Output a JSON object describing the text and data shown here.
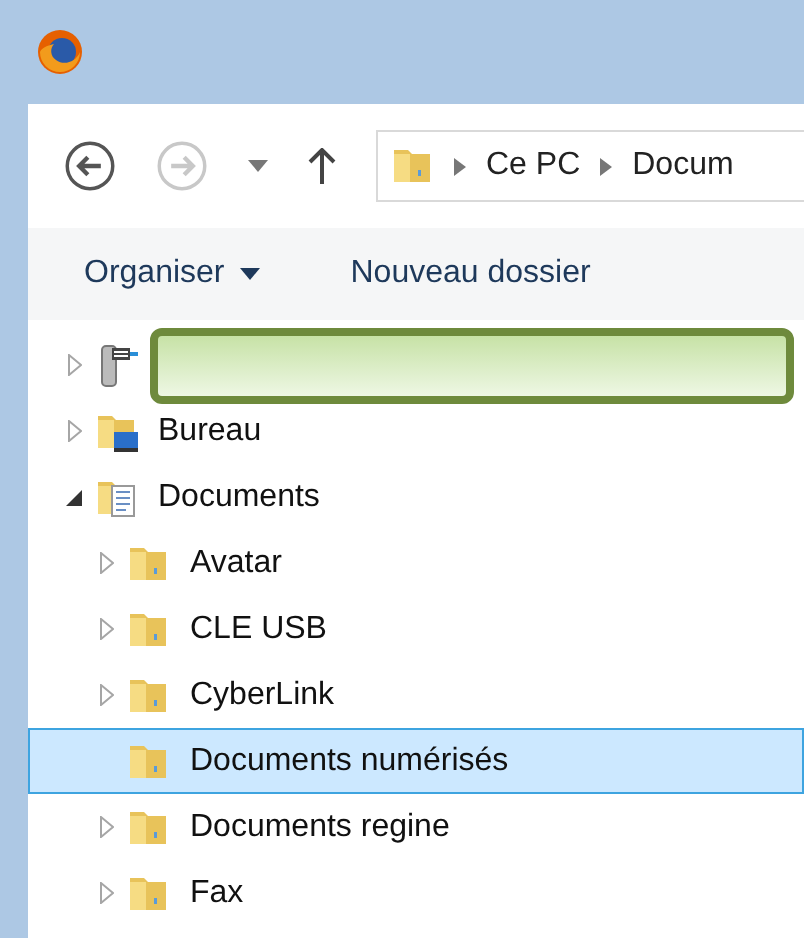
{
  "navigation": {
    "back_disabled": false,
    "forward_disabled": true
  },
  "breadcrumb": [
    "Ce PC",
    "Docum"
  ],
  "toolbar": [
    {
      "label": "Organiser",
      "dropdown": true
    },
    {
      "label": "Nouveau dossier",
      "dropdown": false
    }
  ],
  "tree": [
    {
      "kind": "network",
      "expandable": true,
      "expanded": false,
      "selected": false,
      "redacted": true
    },
    {
      "label": "Bureau",
      "kind": "desktop",
      "expandable": true,
      "expanded": false,
      "selected": false
    },
    {
      "label": "Documents",
      "kind": "documents",
      "expandable": true,
      "expanded": true,
      "selected": false,
      "children": [
        {
          "label": "Avatar",
          "kind": "folder",
          "expandable": true,
          "expanded": false,
          "selected": false
        },
        {
          "label": "CLE USB",
          "kind": "folder",
          "expandable": true,
          "expanded": false,
          "selected": false
        },
        {
          "label": "CyberLink",
          "kind": "folder",
          "expandable": true,
          "expanded": false,
          "selected": false
        },
        {
          "label": "Documents numérisés",
          "kind": "folder",
          "expandable": false,
          "expanded": false,
          "selected": true
        },
        {
          "label": "Documents regine",
          "kind": "folder",
          "expandable": true,
          "expanded": false,
          "selected": false
        },
        {
          "label": "Fax",
          "kind": "folder",
          "expandable": true,
          "expanded": false,
          "selected": false
        }
      ]
    }
  ]
}
